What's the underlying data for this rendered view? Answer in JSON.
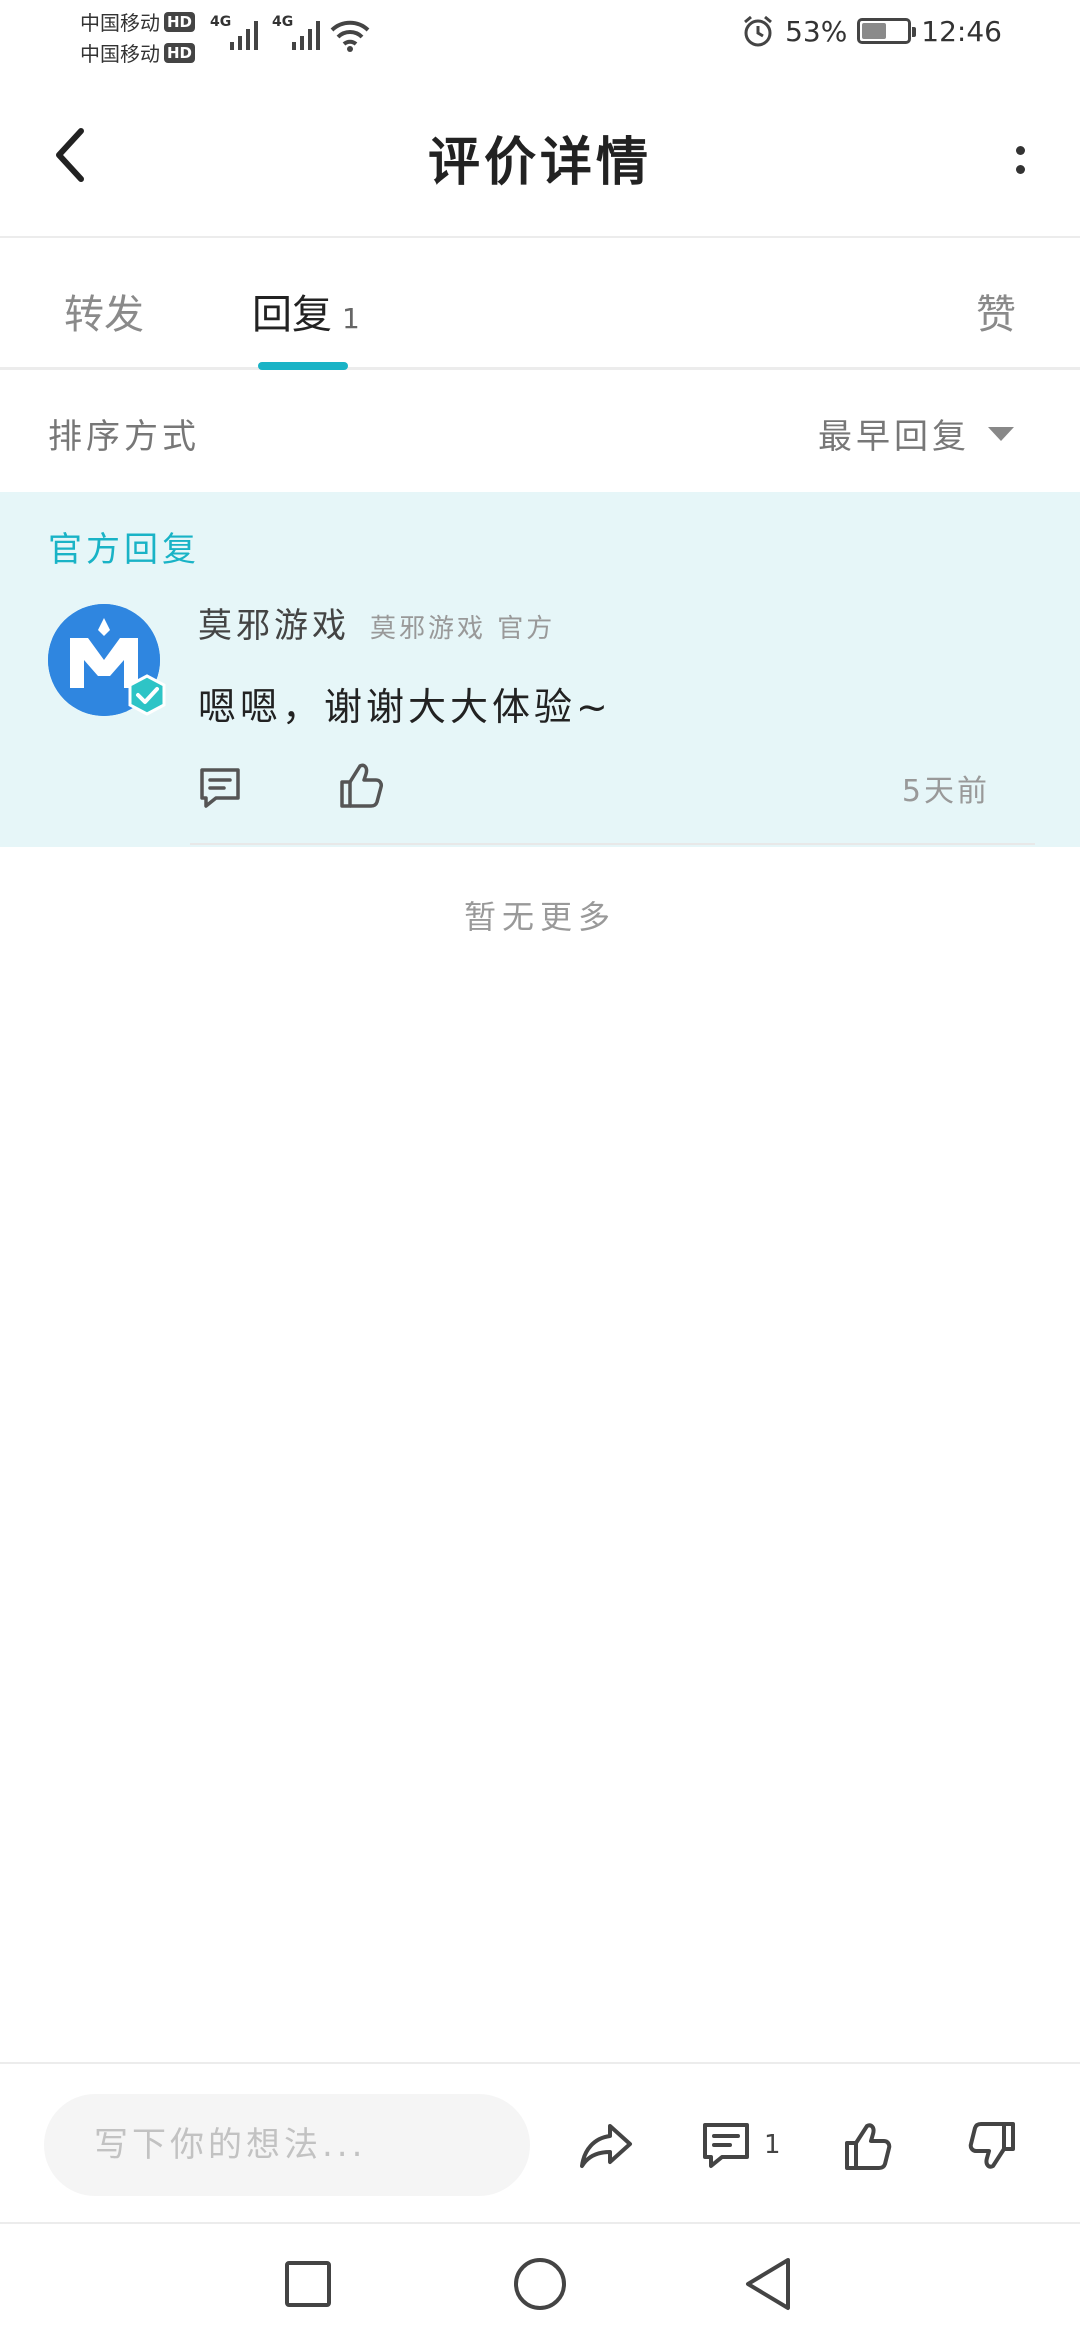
{
  "status_bar": {
    "carrier_1": "中国移动",
    "carrier_2": "中国移动",
    "hd_badge": "HD",
    "network_1": "4G",
    "network_2": "4G",
    "battery_percent": "53%",
    "battery_level": 0.53,
    "time": "12:46"
  },
  "header": {
    "title": "评价详情"
  },
  "tabs": {
    "forward_label": "转发",
    "reply_label": "回复",
    "reply_count": "1",
    "like_label": "赞"
  },
  "sort": {
    "label": "排序方式",
    "selected": "最早回复"
  },
  "official_reply": {
    "section_label": "官方回复",
    "author_name": "莫邪游戏",
    "author_tag": "莫邪游戏 官方",
    "text": "嗯嗯，谢谢大大体验~",
    "time": "5天前"
  },
  "no_more_text": "暂无更多",
  "bottom_bar": {
    "input_placeholder": "写下你的想法...",
    "comment_count": "1"
  },
  "colors": {
    "accent": "#19b3c6",
    "official_bg": "#e6f6f8",
    "avatar_bg": "#2f86e0"
  }
}
